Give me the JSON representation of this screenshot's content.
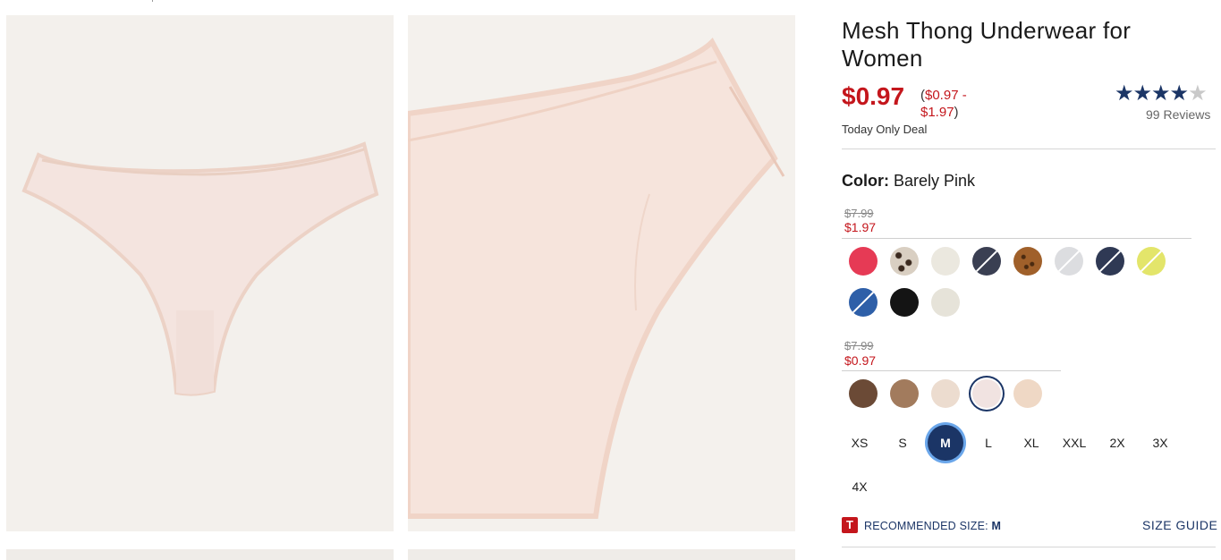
{
  "product": {
    "title": "Mesh Thong Underwear for Women",
    "price_now": "$0.97",
    "price_range_open": "(",
    "price_range_low": "$0.97 -",
    "price_range_high": "$1.97",
    "price_range_close": ")",
    "deal_label": "Today Only Deal",
    "rating_stars": 4.5,
    "reviews_label": "99 Reviews"
  },
  "color": {
    "label": "Color:",
    "value": "Barely Pink"
  },
  "price_groups": [
    {
      "was": "$7.99",
      "sale": "$1.97",
      "swatches": [
        {
          "name": "hot-pink",
          "color": "#e63a55",
          "unavailable": false
        },
        {
          "name": "leopard-print",
          "color": "#d9cfc2",
          "unavailable": false
        },
        {
          "name": "cream",
          "color": "#ebe8df",
          "unavailable": false
        },
        {
          "name": "navy-dots",
          "color": "#3a3f52",
          "unavailable": true
        },
        {
          "name": "cheetah-brown",
          "color": "#a0602a",
          "unavailable": false
        },
        {
          "name": "light-gray",
          "color": "#dcdde0",
          "unavailable": true
        },
        {
          "name": "navy",
          "color": "#2f3954",
          "unavailable": true
        },
        {
          "name": "yellow",
          "color": "#e3e56a",
          "unavailable": true
        },
        {
          "name": "blue",
          "color": "#2e5fa8",
          "unavailable": true
        },
        {
          "name": "black",
          "color": "#141414",
          "unavailable": false
        },
        {
          "name": "ivory",
          "color": "#e6e3d9",
          "unavailable": false
        }
      ]
    },
    {
      "was": "$7.99",
      "sale": "$0.97",
      "swatches": [
        {
          "name": "cocoa",
          "color": "#6b4a36",
          "unavailable": false
        },
        {
          "name": "caramel",
          "color": "#a27b5d",
          "unavailable": false
        },
        {
          "name": "nude-light",
          "color": "#ecdccf",
          "unavailable": false
        },
        {
          "name": "barely-pink",
          "color": "#f1e3e1",
          "unavailable": false,
          "selected": true
        },
        {
          "name": "peach",
          "color": "#efd8c5",
          "unavailable": false
        }
      ]
    }
  ],
  "sizes": [
    {
      "label": "XS",
      "selected": false
    },
    {
      "label": "S",
      "selected": false
    },
    {
      "label": "M",
      "selected": true
    },
    {
      "label": "L",
      "selected": false
    },
    {
      "label": "XL",
      "selected": false
    },
    {
      "label": "XXL",
      "selected": false
    },
    {
      "label": "2X",
      "selected": false
    },
    {
      "label": "3X",
      "selected": false
    },
    {
      "label": "4X",
      "selected": false
    }
  ],
  "recommendation": {
    "icon_letter": "T",
    "label": "RECOMMENDED SIZE:",
    "size": "M",
    "size_guide_label": "SIZE GUIDE"
  },
  "icons": {
    "true-fit": "true-fit-icon",
    "star": "star-icon"
  }
}
